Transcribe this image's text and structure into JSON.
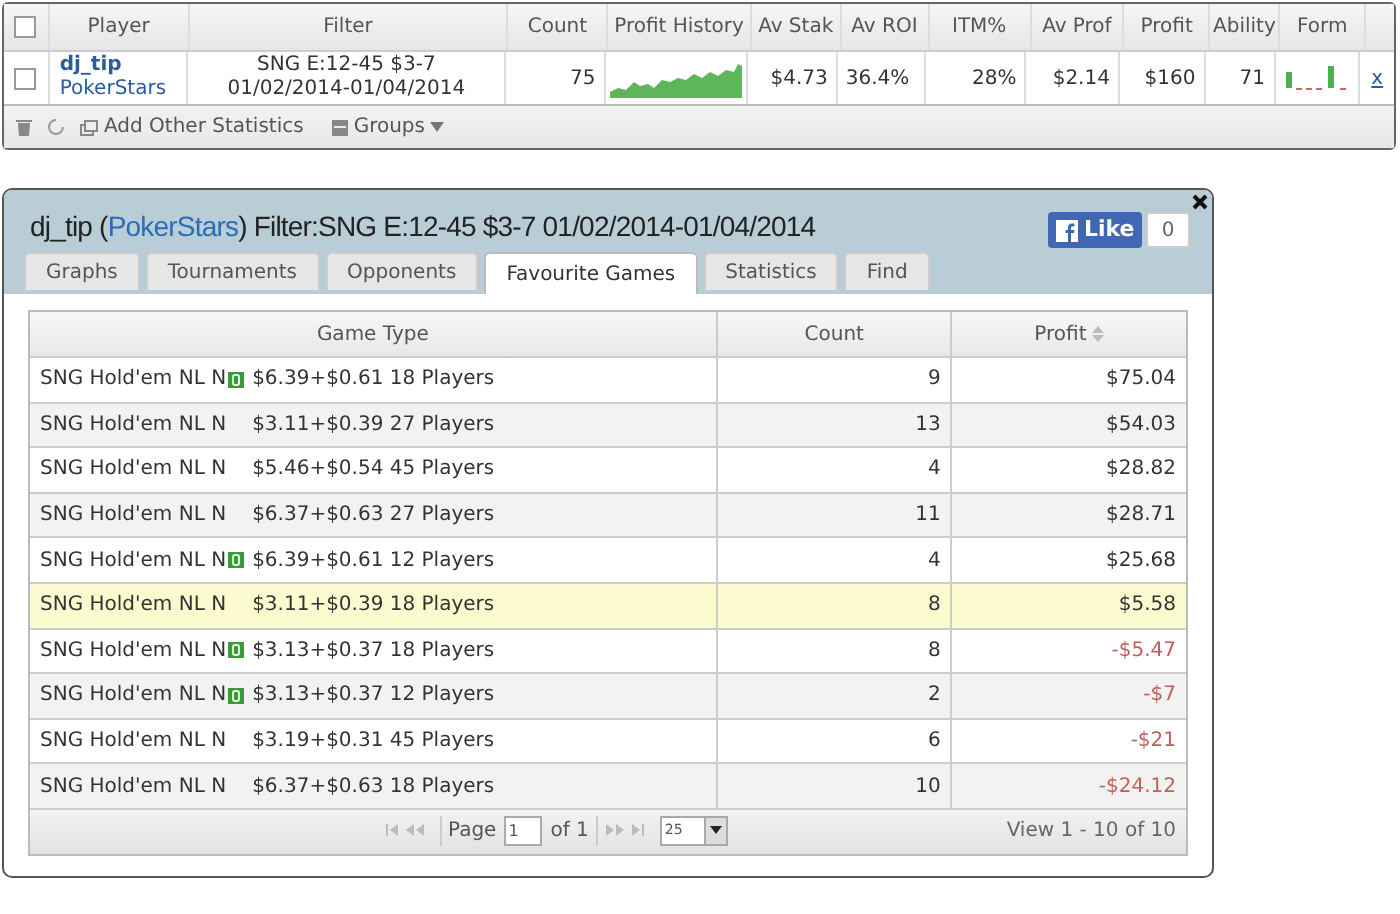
{
  "summary": {
    "columns": [
      "Player",
      "Filter",
      "Count",
      "Profit History",
      "Av Stak",
      "Av ROI",
      "ITM%",
      "Av Prof",
      "Profit",
      "Ability",
      "Form"
    ],
    "select_all_checked": false,
    "row": {
      "checked": false,
      "player": "dj_tip",
      "site": "PokerStars",
      "filter": [
        "SNG E:12-45 $3-7",
        "01/02/2014-01/04/2014"
      ],
      "count": "75",
      "av_stake": "$4.73",
      "av_roi": "36.4%",
      "itm": "28%",
      "av_profit": "$2.14",
      "profit": "$160",
      "ability": "71",
      "remove": "x"
    },
    "toolbar": [
      "Add Other Statistics",
      "Groups"
    ]
  },
  "dialog": {
    "title": {
      "before": "dj_tip (",
      "site": "PokerStars",
      "after": ") Filter:SNG E:12-45 $3-7 01/02/2014-01/04/2014"
    },
    "like": {
      "label": "Like",
      "count": "0"
    },
    "tabs": [
      {
        "label": "Graphs",
        "selected": false
      },
      {
        "label": "Tournaments",
        "selected": false
      },
      {
        "label": "Opponents",
        "selected": false
      },
      {
        "label": "Favourite Games",
        "selected": true
      },
      {
        "label": "Statistics",
        "selected": false
      },
      {
        "label": "Find",
        "selected": false
      }
    ],
    "columns": [
      "Game Type",
      "Count",
      "Profit"
    ],
    "rows": [
      {
        "type": "SNG Hold'em NL N",
        "badge": true,
        "detail": "$6.39+$0.61 18 Players",
        "count": "9",
        "profit": "$75.04",
        "loss": false,
        "selected": false
      },
      {
        "type": "SNG Hold'em NL N",
        "badge": false,
        "detail": "$3.11+$0.39 27 Players",
        "count": "13",
        "profit": "$54.03",
        "loss": false,
        "selected": false
      },
      {
        "type": "SNG Hold'em NL N",
        "badge": false,
        "detail": "$5.46+$0.54 45 Players",
        "count": "4",
        "profit": "$28.82",
        "loss": false,
        "selected": false
      },
      {
        "type": "SNG Hold'em NL N",
        "badge": false,
        "detail": "$6.37+$0.63 27 Players",
        "count": "11",
        "profit": "$28.71",
        "loss": false,
        "selected": false
      },
      {
        "type": "SNG Hold'em NL N",
        "badge": true,
        "detail": "$6.39+$0.61 12 Players",
        "count": "4",
        "profit": "$25.68",
        "loss": false,
        "selected": false
      },
      {
        "type": "SNG Hold'em NL N",
        "badge": false,
        "detail": "$3.11+$0.39 18 Players",
        "count": "8",
        "profit": "$5.58",
        "loss": false,
        "selected": true
      },
      {
        "type": "SNG Hold'em NL N",
        "badge": true,
        "detail": "$3.13+$0.37 18 Players",
        "count": "8",
        "profit": "-$5.47",
        "loss": true,
        "selected": false
      },
      {
        "type": "SNG Hold'em NL N",
        "badge": true,
        "detail": "$3.13+$0.37 12 Players",
        "count": "2",
        "profit": "-$7",
        "loss": true,
        "selected": false
      },
      {
        "type": "SNG Hold'em NL N",
        "badge": false,
        "detail": "$3.19+$0.31 45 Players",
        "count": "6",
        "profit": "-$21",
        "loss": true,
        "selected": false
      },
      {
        "type": "SNG Hold'em NL N",
        "badge": false,
        "detail": "$6.37+$0.63 18 Players",
        "count": "10",
        "profit": "-$24.12",
        "loss": true,
        "selected": false
      }
    ],
    "pager": {
      "page_label": "Page",
      "page": "1",
      "of": "of 1",
      "per_page": "25",
      "view": "View 1 - 10 of 10"
    }
  }
}
